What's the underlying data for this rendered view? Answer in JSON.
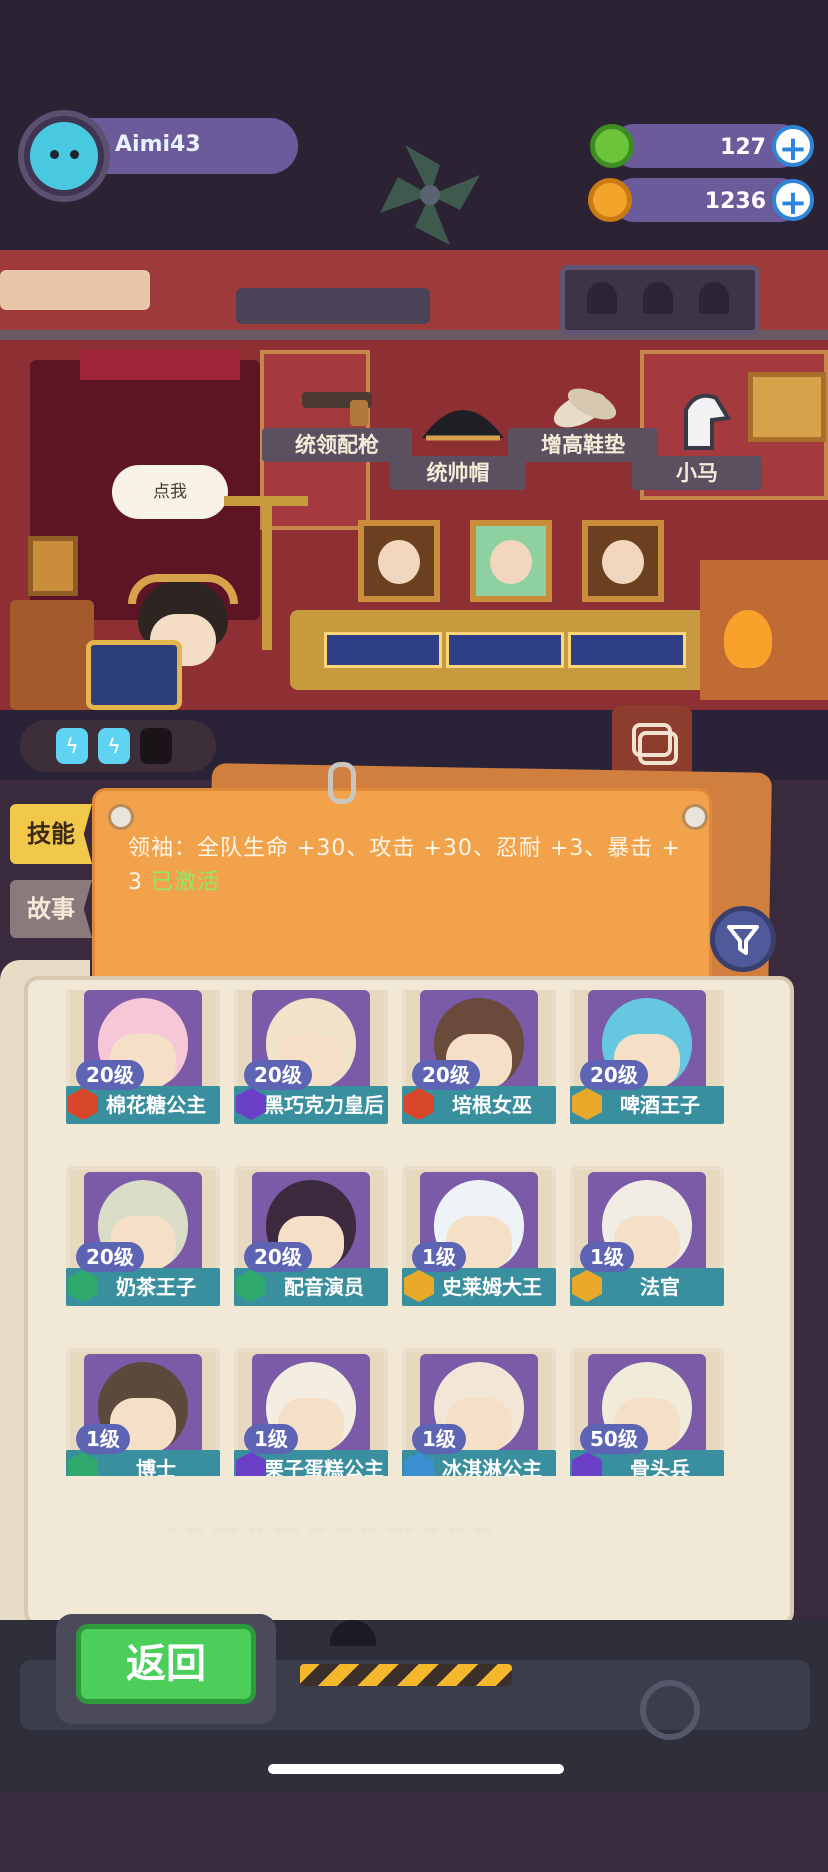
{
  "player": {
    "name": "Aimi43"
  },
  "currencies": [
    {
      "icon": "donut-icon",
      "value": "127",
      "color": "#6bc43a"
    },
    {
      "icon": "planet-coin-icon",
      "value": "1236",
      "color": "#f3a529"
    }
  ],
  "room": {
    "speech_bubble": "点我",
    "items": [
      "统领配枪",
      "统帅帽",
      "增高鞋垫",
      "小马"
    ],
    "energy_slots": [
      "filled",
      "filled",
      "empty"
    ]
  },
  "tabs": {
    "skill": "技能",
    "story": "故事"
  },
  "skill": {
    "text": "领袖：全队生命 +30、攻击 +30、忍耐 +3、暴击 + 3",
    "status": "已激活"
  },
  "roster": [
    {
      "level": "20级",
      "name": "棉花糖公主",
      "badge_color": "#d9472b",
      "art": "#f6c7d6"
    },
    {
      "level": "20级",
      "name": "黑巧克力皇后",
      "badge_color": "#6b3fc7",
      "art": "#f0e3c9"
    },
    {
      "level": "20级",
      "name": "培根女巫",
      "badge_color": "#d9472b",
      "art": "#6a4a3a"
    },
    {
      "level": "20级",
      "name": "啤酒王子",
      "badge_color": "#e8a92a",
      "art": "#65c8e0"
    },
    {
      "level": "20级",
      "name": "奶茶王子",
      "badge_color": "#2fa86b",
      "art": "#d9dcc7"
    },
    {
      "level": "20级",
      "name": "配音演员",
      "badge_color": "#2fa86b",
      "art": "#3c2a3e"
    },
    {
      "level": "1级",
      "name": "史莱姆大王",
      "badge_color": "#e8a92a",
      "art": "#eef3f8"
    },
    {
      "level": "1级",
      "name": "法官",
      "badge_color": "#e8a92a",
      "art": "#f1ece4"
    },
    {
      "level": "1级",
      "name": "博士",
      "badge_color": "#2fa86b",
      "art": "#5b4a3c"
    },
    {
      "level": "1级",
      "name": "栗子蛋糕公主",
      "badge_color": "#6b3fc7",
      "art": "#f4ede2"
    },
    {
      "level": "1级",
      "name": "冰淇淋公主",
      "badge_color": "#3a8fd0",
      "art": "#f2e7d6"
    },
    {
      "level": "50级",
      "name": "骨头兵",
      "badge_color": "#6b3fc7",
      "art": "#f1ecd9"
    }
  ],
  "back_button": "返回",
  "colors": {
    "accent_teal": "#3a8f9f",
    "level_pill": "#5d64b3",
    "skill_green": "#8eea6a"
  }
}
